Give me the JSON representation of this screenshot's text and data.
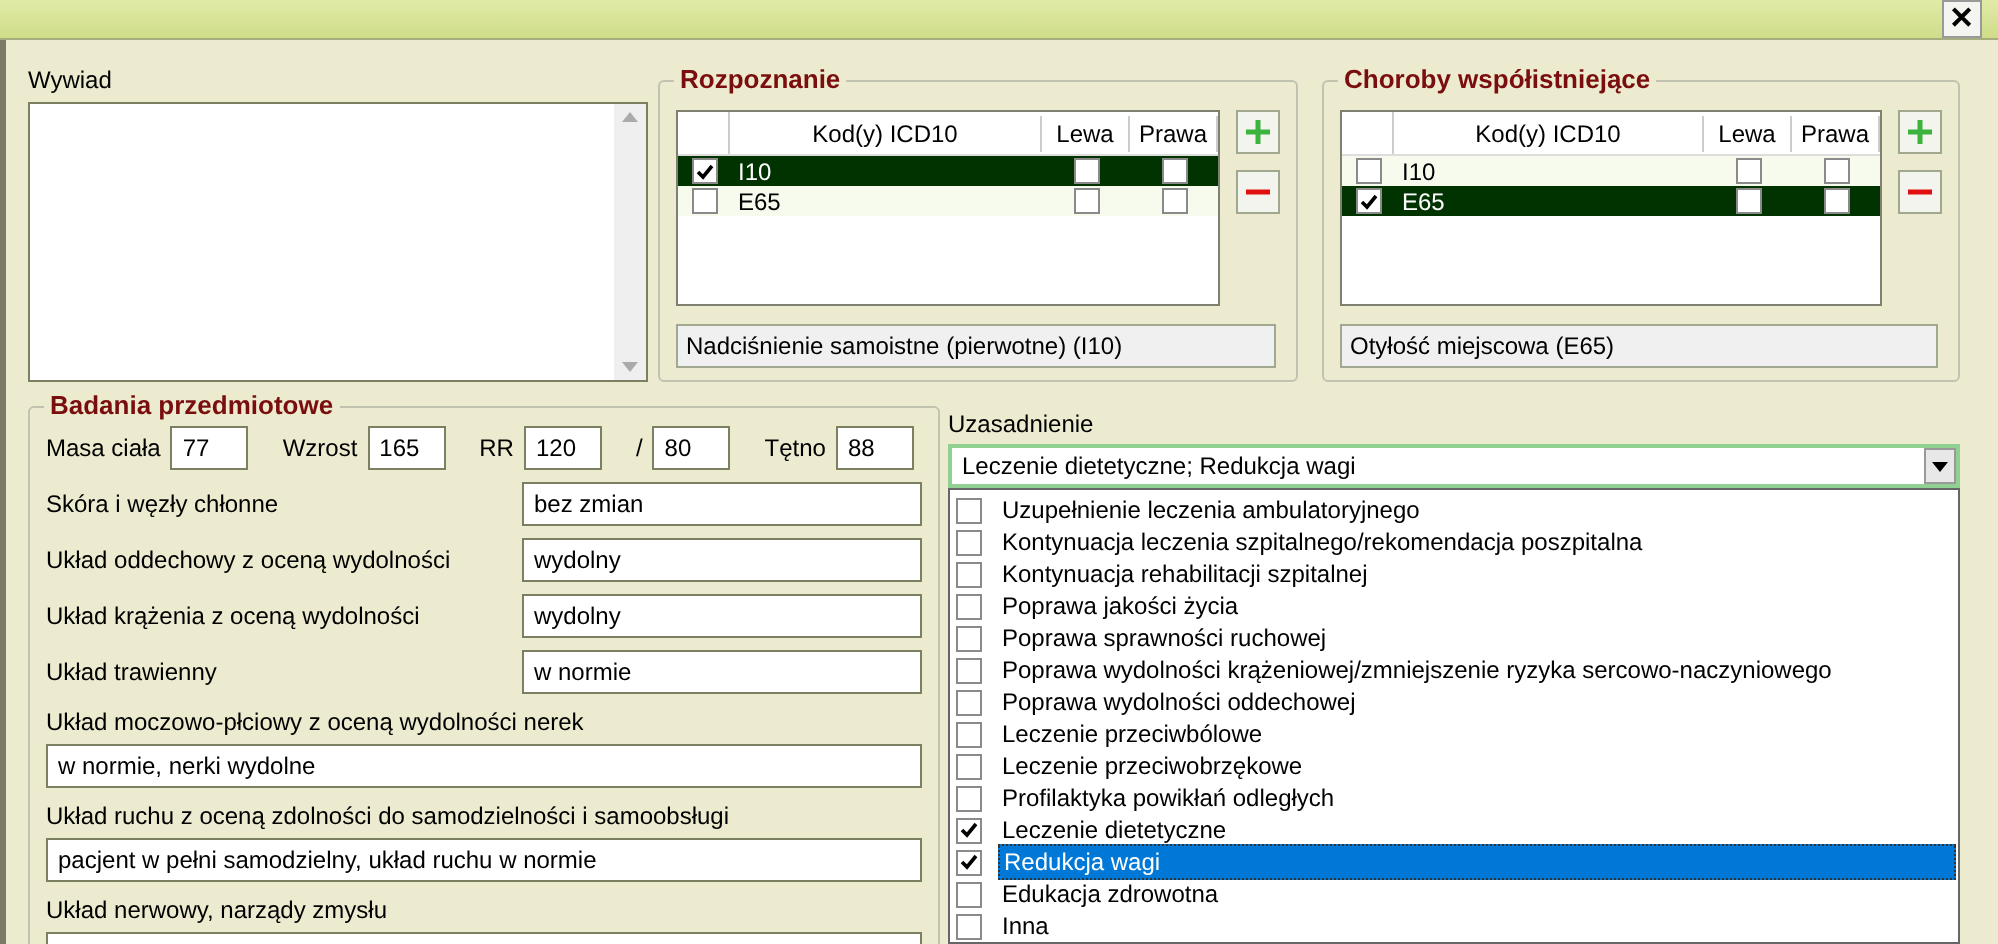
{
  "close_button": "✕",
  "interview": {
    "label": "Wywiad"
  },
  "diagnosis": {
    "title": "Rozpoznanie",
    "columns": [
      "Kod(y) ICD10",
      "Lewa",
      "Prawa"
    ],
    "rows": [
      {
        "code": "I10",
        "checked": true,
        "left": false,
        "right": false,
        "selected": true
      },
      {
        "code": "E65",
        "checked": false,
        "left": false,
        "right": false,
        "selected": false
      }
    ],
    "description": "Nadciśnienie samoistne (pierwotne) (I10)"
  },
  "comorbidities": {
    "title": "Choroby współistniejące",
    "columns": [
      "Kod(y) ICD10",
      "Lewa",
      "Prawa"
    ],
    "rows": [
      {
        "code": "I10",
        "checked": false,
        "left": false,
        "right": false,
        "selected": false
      },
      {
        "code": "E65",
        "checked": true,
        "left": false,
        "right": false,
        "selected": true
      }
    ],
    "description": "Otyłość miejscowa (E65)"
  },
  "exam": {
    "title": "Badania przedmiotowe",
    "vitals": [
      {
        "label": "Masa ciała",
        "value": "77"
      },
      {
        "label": "Wzrost",
        "value": "165"
      },
      {
        "label": "RR",
        "value": "120"
      },
      {
        "label": "/",
        "value": "80"
      },
      {
        "label": "Tętno",
        "value": "88"
      }
    ],
    "inline_fields": [
      {
        "label": "Skóra i węzły chłonne",
        "value": "bez zmian"
      },
      {
        "label": "Układ oddechowy z oceną wydolności",
        "value": "wydolny"
      },
      {
        "label": "Układ krążenia z oceną wydolności",
        "value": "wydolny"
      },
      {
        "label": "Układ trawienny",
        "value": "w normie"
      }
    ],
    "wide_fields": [
      {
        "label": "Układ moczowo-płciowy z oceną wydolności nerek",
        "value": "w normie, nerki wydolne"
      },
      {
        "label": "Układ ruchu z oceną zdolności do samodzielności i samoobsługi",
        "value": "pacjent w pełni samodzielny, układ ruchu w normie"
      },
      {
        "label": "Układ nerwowy, narządy zmysłu"
      }
    ]
  },
  "justification": {
    "label": "Uzasadnienie",
    "value": "Leczenie dietetyczne; Redukcja wagi",
    "options": [
      {
        "label": "Uzupełnienie leczenia ambulatoryjnego",
        "checked": false,
        "selected": false
      },
      {
        "label": "Kontynuacja leczenia szpitalnego/rekomendacja poszpitalna",
        "checked": false,
        "selected": false
      },
      {
        "label": "Kontynuacja rehabilitacji szpitalnej",
        "checked": false,
        "selected": false
      },
      {
        "label": "Poprawa jakości życia",
        "checked": false,
        "selected": false
      },
      {
        "label": "Poprawa sprawności ruchowej",
        "checked": false,
        "selected": false
      },
      {
        "label": "Poprawa wydolności krążeniowej/zmniejszenie ryzyka sercowo-naczyniowego",
        "checked": false,
        "selected": false
      },
      {
        "label": "Poprawa wydolności oddechowej",
        "checked": false,
        "selected": false
      },
      {
        "label": "Leczenie przeciwbólowe",
        "checked": false,
        "selected": false
      },
      {
        "label": "Leczenie przeciwobrzękowe",
        "checked": false,
        "selected": false
      },
      {
        "label": "Profilaktyka powikłań odległych",
        "checked": false,
        "selected": false
      },
      {
        "label": "Leczenie dietetyczne",
        "checked": true,
        "selected": false
      },
      {
        "label": "Redukcja wagi",
        "checked": true,
        "selected": true
      },
      {
        "label": "Edukacja zdrowotna",
        "checked": false,
        "selected": false
      },
      {
        "label": "Inna",
        "checked": false,
        "selected": false
      }
    ]
  }
}
